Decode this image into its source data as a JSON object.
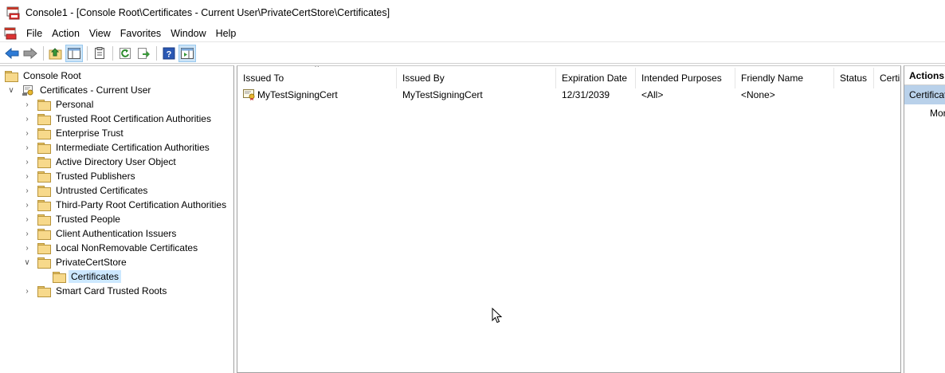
{
  "window": {
    "title": "Console1 - [Console Root\\Certificates - Current User\\PrivateCertStore\\Certificates]"
  },
  "menu": {
    "items": [
      "File",
      "Action",
      "View",
      "Favorites",
      "Window",
      "Help"
    ]
  },
  "toolbar": {
    "icons": [
      "back-icon",
      "forward-icon",
      "up-folder-icon",
      "show-hide-tree-icon",
      "properties-icon",
      "refresh-icon",
      "export-list-icon",
      "help-icon",
      "show-hide-action-pane-icon"
    ]
  },
  "tree": {
    "root": "Console Root",
    "store": "Certificates - Current User",
    "folders": [
      "Personal",
      "Trusted Root Certification Authorities",
      "Enterprise Trust",
      "Intermediate Certification Authorities",
      "Active Directory User Object",
      "Trusted Publishers",
      "Untrusted Certificates",
      "Third-Party Root Certification Authorities",
      "Trusted People",
      "Client Authentication Issuers",
      "Local NonRemovable Certificates",
      "PrivateCertStore"
    ],
    "selected_child": "Certificates",
    "last_folder": "Smart Card Trusted Roots"
  },
  "list": {
    "columns": [
      "Issued To",
      "Issued By",
      "Expiration Date",
      "Intended Purposes",
      "Friendly Name",
      "Status",
      "Certi"
    ],
    "rows": [
      {
        "issued_to": "MyTestSigningCert",
        "issued_by": "MyTestSigningCert",
        "expiration": "12/31/2039",
        "purposes": "<All>",
        "friendly_name": "<None>",
        "status": "",
        "template": ""
      }
    ]
  },
  "actions": {
    "header": "Actions",
    "section": "Certificates",
    "more": "More Actions"
  }
}
